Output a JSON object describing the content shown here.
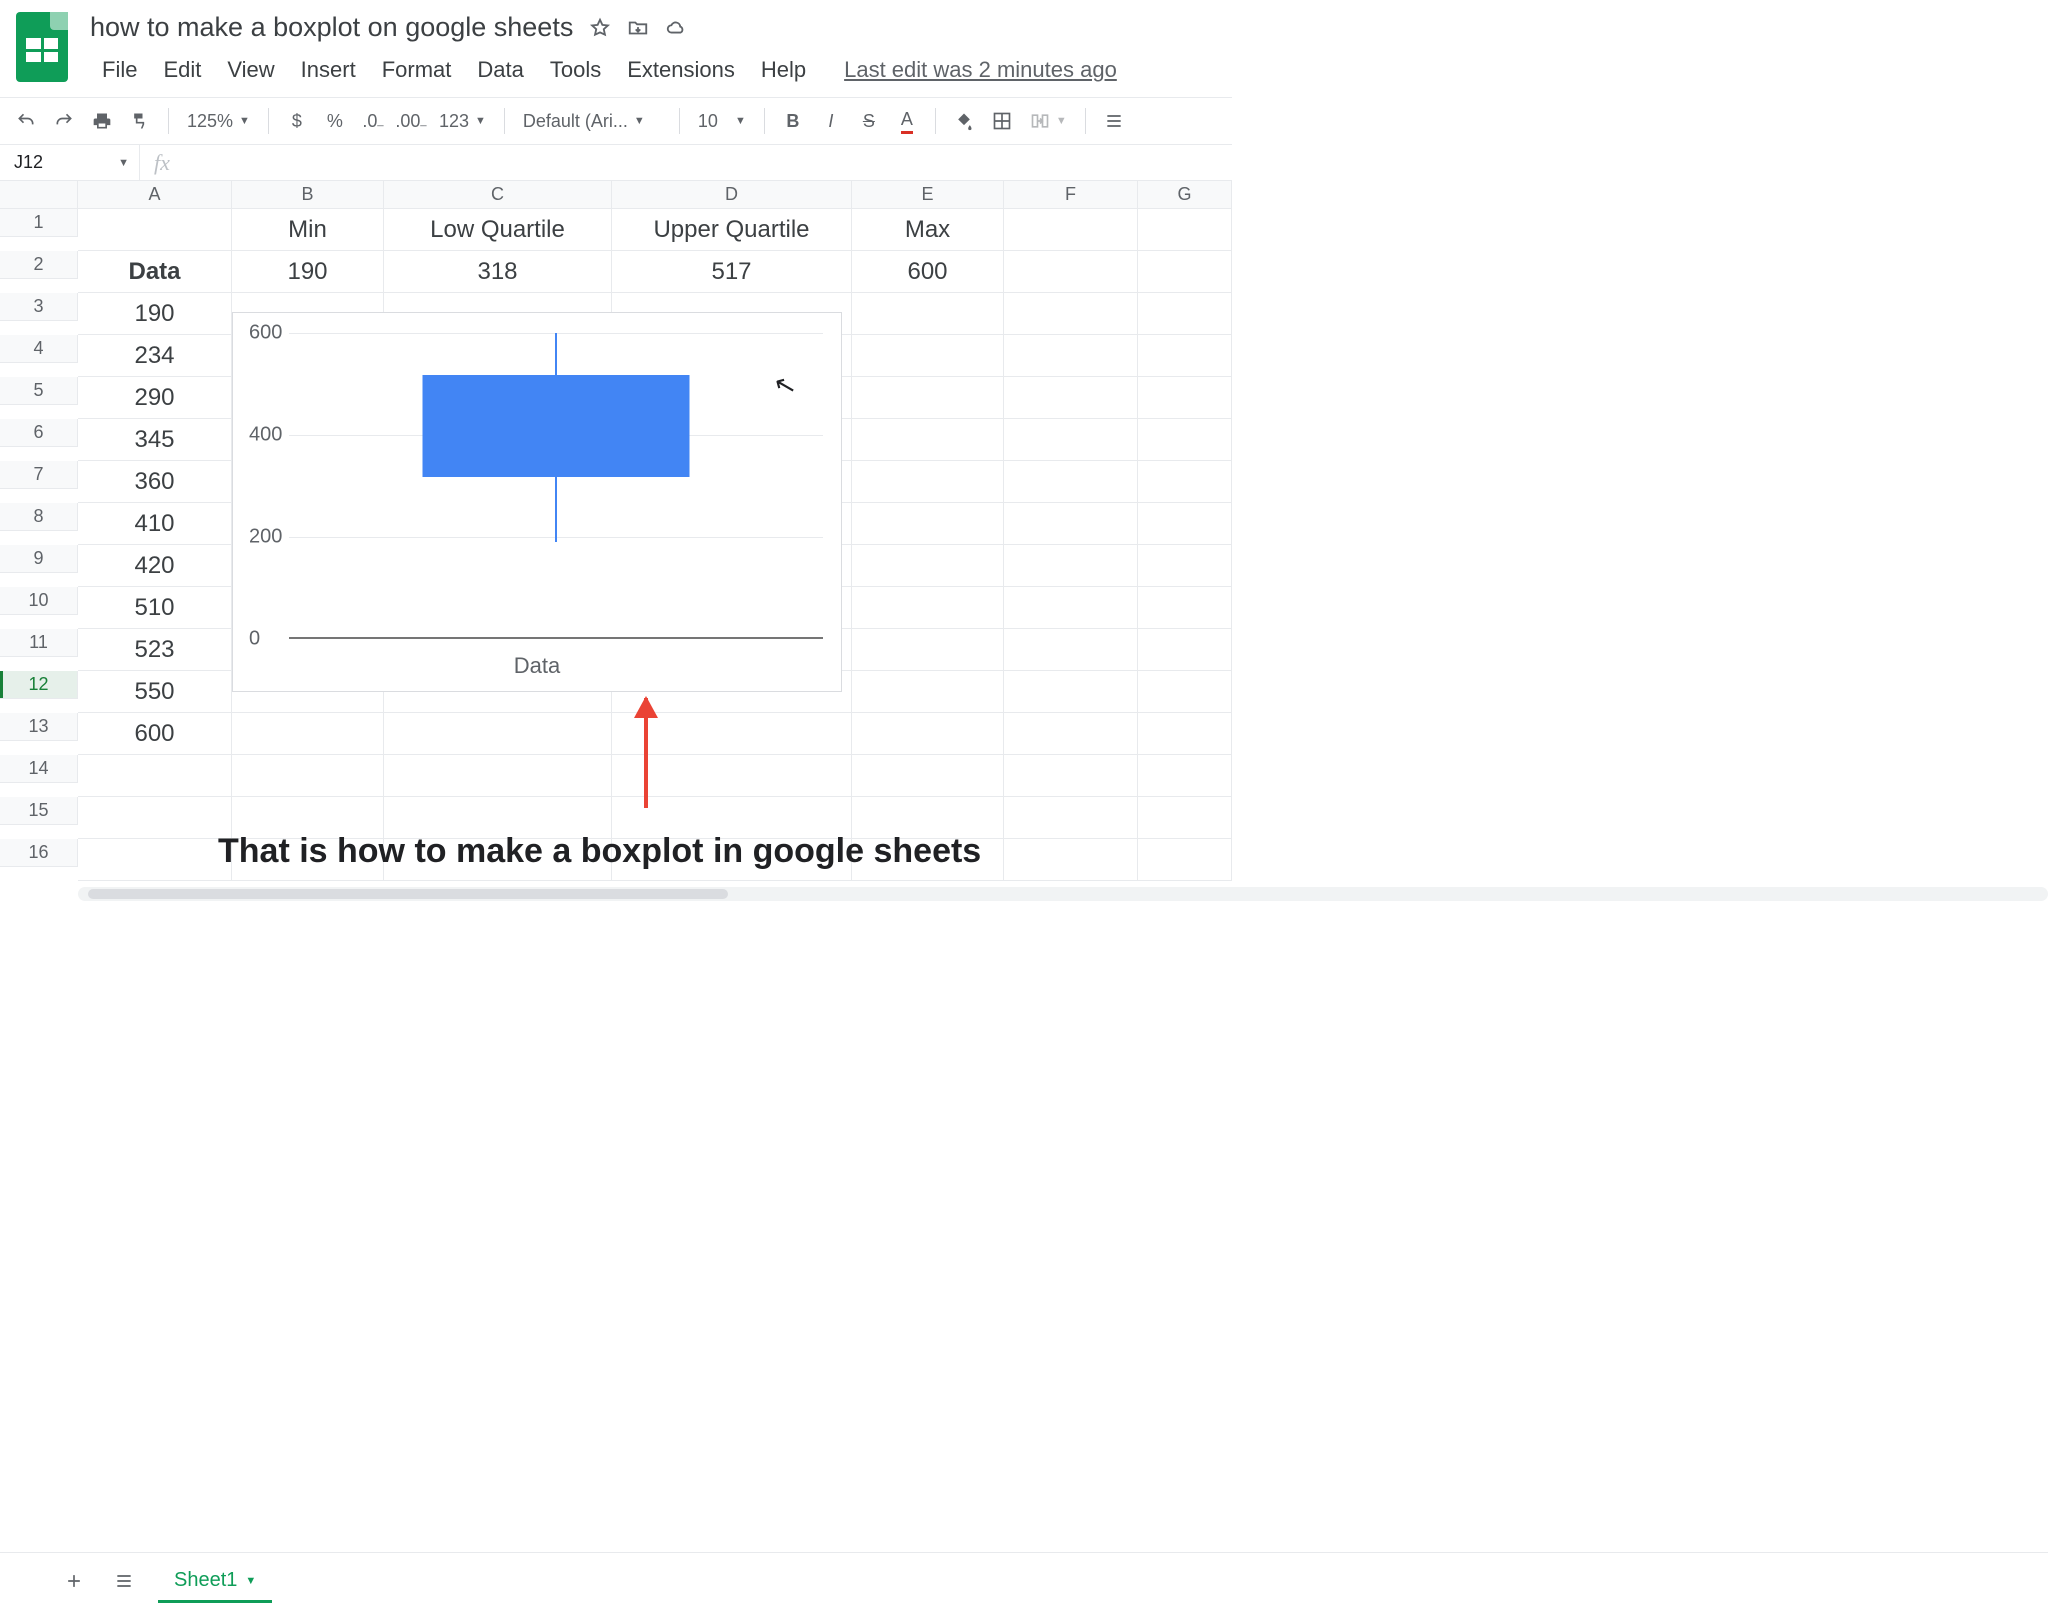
{
  "doc": {
    "title": "how to make a boxplot on google sheets",
    "last_edit": "Last edit was 2 minutes ago"
  },
  "menus": [
    "File",
    "Edit",
    "View",
    "Insert",
    "Format",
    "Data",
    "Tools",
    "Extensions",
    "Help"
  ],
  "toolbar": {
    "zoom": "125%",
    "num_format": "123",
    "font": "Default (Ari...",
    "font_size": "10"
  },
  "namebox": {
    "ref": "J12"
  },
  "columns": [
    "A",
    "B",
    "C",
    "D",
    "E",
    "F",
    "G"
  ],
  "row_headers": [
    "1",
    "2",
    "3",
    "4",
    "5",
    "6",
    "7",
    "8",
    "9",
    "10",
    "11",
    "12",
    "13",
    "14",
    "15",
    "16"
  ],
  "stats": {
    "labels": {
      "min": "Min",
      "low": "Low Quartile",
      "up": "Upper Quartile",
      "max": "Max"
    },
    "values": {
      "min": "190",
      "low": "318",
      "up": "517",
      "max": "600"
    }
  },
  "data_header": "Data",
  "data_values": [
    "190",
    "234",
    "290",
    "345",
    "360",
    "410",
    "420",
    "510",
    "523",
    "550",
    "600"
  ],
  "annotation_caption": "That is how to make a boxplot in google sheets",
  "tabs": {
    "sheet1": "Sheet1"
  },
  "chart_data": {
    "type": "boxplot",
    "category": "Data",
    "min": 190,
    "q1": 318,
    "q3": 517,
    "max": 600,
    "y_ticks": [
      0,
      200,
      400,
      600
    ],
    "ylim": [
      0,
      600
    ],
    "xlabel": "Data"
  }
}
